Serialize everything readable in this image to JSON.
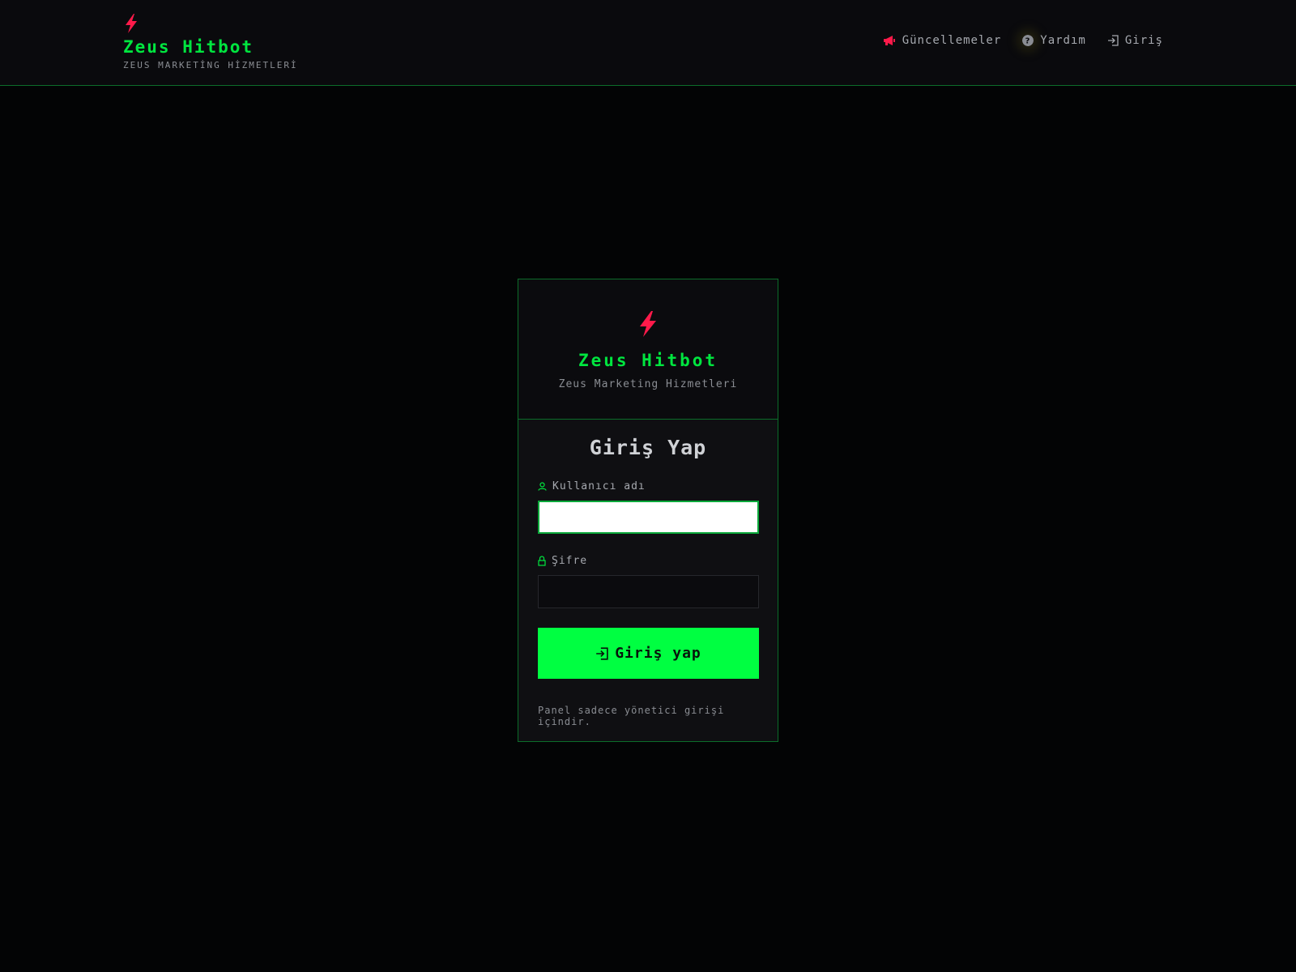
{
  "header": {
    "brand_title": "Zeus Hitbot",
    "brand_subtitle": "ZEUS MARKETİNG HİZMETLERİ",
    "nav": [
      {
        "label": "Güncellemeler",
        "icon": "megaphone-icon"
      },
      {
        "label": "Yardım",
        "icon": "help-circle-icon"
      },
      {
        "label": "Giriş",
        "icon": "login-icon"
      }
    ]
  },
  "card": {
    "title": "Zeus Hitbot",
    "subtitle": "Zeus Marketing Hizmetleri",
    "form_title": "Giriş Yap",
    "username_label": "Kullanıcı adı",
    "username_value": "",
    "password_label": "Şifre",
    "password_value": "",
    "submit_label": "Giriş yap",
    "note": "Panel sadece yönetici girişi içindir."
  },
  "colors": {
    "accent_green": "#00ff41",
    "brand_red": "#ff1a4a",
    "border_green": "#0c6d2a"
  }
}
